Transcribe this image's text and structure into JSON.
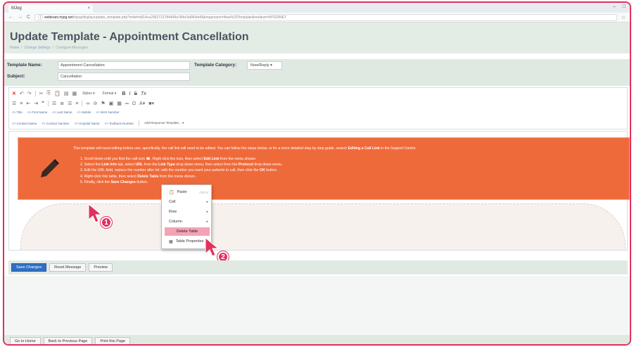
{
  "browser": {
    "tab_title": "MJog",
    "tab_close": "×",
    "window_min": "–",
    "window_max": "□",
    "url_host": "webinars.mjog.net",
    "url_path": "/mjog/display/update_template.php?mdid=a814ca2062712784449a784e3a840eb58&mapname=New%20Template&medium=INTERNET"
  },
  "header": {
    "title": "Update Template - Appointment Cancellation",
    "breadcrumb": [
      "Home",
      "Change Settings",
      "Configure Messages"
    ],
    "separator": "/"
  },
  "form": {
    "template_name_label": "Template Name:",
    "template_name_value": "Appointment Cancellation",
    "category_label": "Template Category:",
    "category_value": "Now/Reply",
    "subject_label": "Subject:",
    "subject_value": "Cancellation"
  },
  "toolbar": {
    "styles": "Styles",
    "format": "Format",
    "bold": "B",
    "italic": "I",
    "strike": "S",
    "clear": "Tx",
    "tags_row1": [
      "<> Title",
      "<> First Name",
      "<> Last Name",
      "<> Mobile",
      "<> NHS Number"
    ],
    "tags_row2": [
      "<> Contact Name",
      "<> Contact Number",
      "<> Hospital Name",
      "<> Textback Number"
    ],
    "add_response": "Add Response Template..."
  },
  "notice": {
    "intro_a": "This template will need editing before use; specifically, the call link will need to be edited. You can follow the steps below, or for a more detailed step by step guide, search ",
    "intro_b": "Editing a Call Link",
    "intro_c": " in the Support Centre.",
    "steps": [
      [
        "1. Scroll down until you find the call icon ",
        "",
        ". Right click the icon, then select ",
        "Edit Link",
        " from the menu shown."
      ],
      [
        "2. Select the ",
        "Link Info",
        " tab, select ",
        "URL",
        " from the ",
        "Link Type",
        " drop down menu, then select ",
        "",
        "from the ",
        "Protocol",
        " drop down menu."
      ],
      [
        "3. Edit the URL field, replace the number after tel: with the number you want your patients to call, then click the ",
        "OK",
        " button."
      ],
      [
        "4. Right-click this table, then select ",
        "Delete Table",
        " from the menu shown."
      ],
      [
        "5. Finally, click the ",
        "Save Changes",
        " button."
      ]
    ]
  },
  "context_menu": {
    "paste": "Paste",
    "paste_hint": "Ctrl+V",
    "cell": "Cell",
    "row": "Row",
    "column": "Column",
    "delete_table": "Delete Table",
    "table_properties": "Table Properties"
  },
  "markers": {
    "one": "1",
    "two": "2"
  },
  "actions": {
    "save": "Save Changes",
    "reset": "Reset Message",
    "preview": "Preview"
  },
  "footer": {
    "home": "Go to Home",
    "back": "Back to Previous Page",
    "print": "Print this Page"
  },
  "colors": {
    "accent": "#e0315f",
    "notice": "#ef6a3a",
    "primary_button": "#2f6fc4",
    "band": "#dfe9e2"
  }
}
